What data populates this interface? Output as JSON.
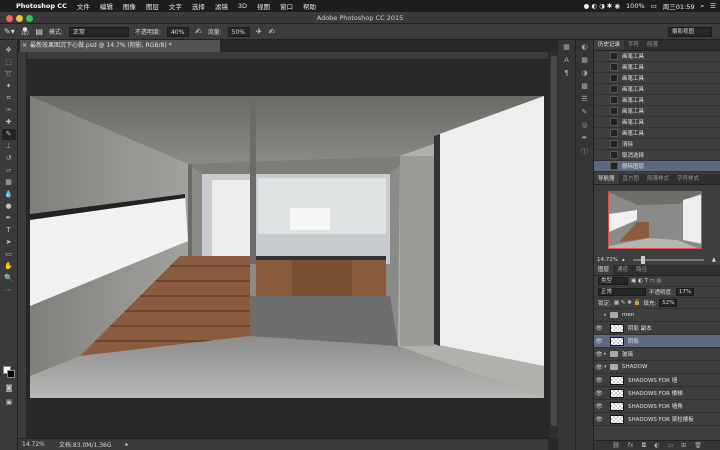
{
  "menubar": {
    "app": "Photoshop CC",
    "items": [
      "文件",
      "编辑",
      "图像",
      "图层",
      "文字",
      "选择",
      "滤镜",
      "3D",
      "视图",
      "窗口",
      "帮助"
    ],
    "battery": "100%",
    "clock": "周三01:59"
  },
  "window": {
    "title": "Adobe Photoshop CC 2015"
  },
  "options": {
    "brush_size": "307",
    "mode_label": "模式:",
    "mode_value": "正常",
    "opacity_label": "不透明度:",
    "opacity_value": "40%",
    "flow_label": "流量:",
    "flow_value": "50%",
    "workspace": "摄影视图"
  },
  "document": {
    "tab_title": "最新效果图沉下心做.psd @ 14.7% (阴影, RGB/8) *"
  },
  "status": {
    "zoom": "14.72%",
    "doc_size": "文档:83.0M/1.36G"
  },
  "history": {
    "tabs": [
      "历史记录",
      "字符",
      "段落"
    ],
    "items": [
      {
        "label": "画笔工具",
        "icon": "brush"
      },
      {
        "label": "画笔工具",
        "icon": "brush"
      },
      {
        "label": "画笔工具",
        "icon": "brush"
      },
      {
        "label": "画笔工具",
        "icon": "brush"
      },
      {
        "label": "画笔工具",
        "icon": "brush"
      },
      {
        "label": "画笔工具",
        "icon": "brush"
      },
      {
        "label": "画笔工具",
        "icon": "brush"
      },
      {
        "label": "画笔工具",
        "icon": "brush"
      },
      {
        "label": "清除",
        "icon": "doc"
      },
      {
        "label": "取消选择",
        "icon": "doc"
      },
      {
        "label": "删除图层",
        "icon": "doc"
      }
    ]
  },
  "navigator": {
    "tabs": [
      "导航器",
      "直方图",
      "段落样式",
      "字符样式"
    ],
    "zoom": "14.72%"
  },
  "layers": {
    "tabs": [
      "图层",
      "通道",
      "路径"
    ],
    "kind_label": "类型",
    "blend": "正常",
    "opacity_label": "不透明度:",
    "opacity": "17%",
    "lock_label": "锁定:",
    "fill_label": "填充:",
    "fill": "52%",
    "rows": [
      {
        "name": "men",
        "type": "group",
        "eye": false
      },
      {
        "name": "阴影 副本",
        "type": "layer",
        "eye": true
      },
      {
        "name": "阴影",
        "type": "layer",
        "eye": true
      },
      {
        "name": "玻璃",
        "type": "group",
        "eye": true
      },
      {
        "name": "SHADOW",
        "type": "group",
        "eye": true
      },
      {
        "name": "SHADOWS FOR 墙",
        "type": "layer",
        "eye": true
      },
      {
        "name": "SHADOWS FOR 楼梯",
        "type": "layer",
        "eye": true
      },
      {
        "name": "SHADOWS FOR 墙角",
        "type": "layer",
        "eye": true
      },
      {
        "name": "SHADOWS FOR 梁柱楼板",
        "type": "layer",
        "eye": true
      }
    ]
  },
  "colors": {
    "selection": "#5c6a7d",
    "accent_red": "#e04a4a"
  }
}
